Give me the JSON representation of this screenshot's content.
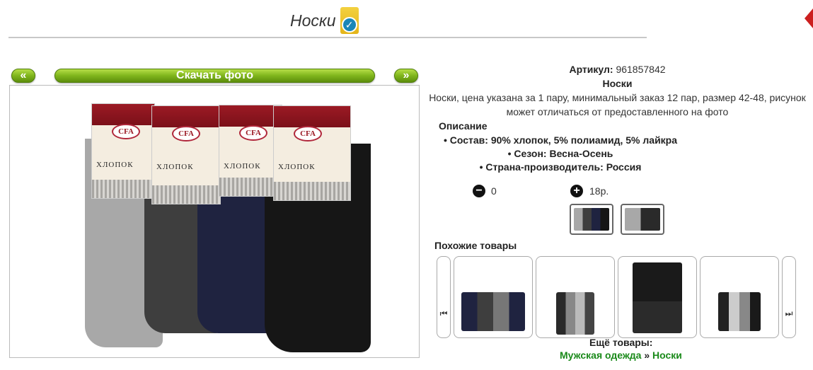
{
  "header": {
    "title": "Носки",
    "badge_icon": "verified-check-icon",
    "corner_icon": "red-arrow-icon"
  },
  "photo_bar": {
    "prev_label": "«",
    "download_label": "Скачать фото",
    "next_label": "»"
  },
  "product": {
    "article_label": "Артикул:",
    "article_value": "961857842",
    "name": "Носки",
    "summary_line1": "Носки, цена указана за 1 пару, минимальный заказ 12 пар, размер 42-48, рисунок",
    "summary_line2": "может отличаться от предоставленного на фото",
    "description_heading": "Описание",
    "bullets": [
      "Состав: 90% хлопок, 5% полиамид, 5% лайкра",
      "Сезон: Весна-Осень",
      "Страна-производитель: Россия"
    ]
  },
  "quantity": {
    "minus_icon": "minus-circle-icon",
    "value": "0",
    "plus_icon": "plus-circle-icon",
    "price": "18р."
  },
  "package_labels": {
    "brand": "CFA",
    "material": "ХЛОПОК"
  },
  "similar": {
    "heading": "Похожие товары",
    "prev_icon": "skip-back-icon",
    "next_icon": "skip-forward-icon"
  },
  "more": {
    "heading": "Ещё товары:",
    "crumb_parent": "Мужская одежда",
    "separator": "»",
    "crumb_child": "Носки"
  },
  "colors": {
    "accent_green": "#7fb51c",
    "link_green": "#1a8a1a",
    "badge_yellow": "#e4b51a"
  }
}
